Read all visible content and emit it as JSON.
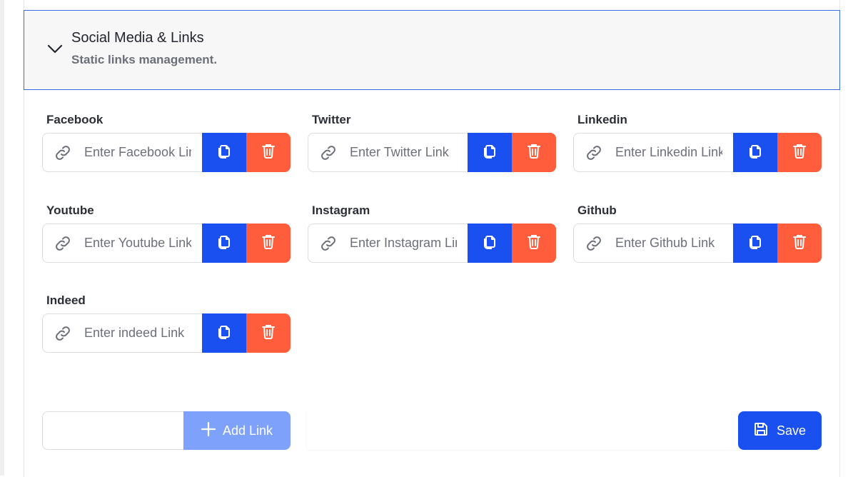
{
  "header": {
    "title": "Social Media & Links",
    "subtitle": "Static links management."
  },
  "fields": [
    {
      "label": "Facebook",
      "placeholder": "Enter Facebook Link"
    },
    {
      "label": "Twitter",
      "placeholder": "Enter Twitter Link"
    },
    {
      "label": "Linkedin",
      "placeholder": "Enter Linkedin Link"
    },
    {
      "label": "Youtube",
      "placeholder": "Enter Youtube Link"
    },
    {
      "label": "Instagram",
      "placeholder": "Enter Instagram Link"
    },
    {
      "label": "Github",
      "placeholder": "Enter Github Link"
    },
    {
      "label": "Indeed",
      "placeholder": "Enter indeed Link"
    }
  ],
  "add": {
    "label": "Add Link",
    "value": ""
  },
  "save": {
    "label": "Save"
  },
  "colors": {
    "primary": "#1a4ff0",
    "danger": "#ff5d3c",
    "add_disabled": "#7ea1fb",
    "header_border": "#3b6ce8"
  },
  "icons": {
    "chevron": "chevron-down-icon",
    "link": "link-icon",
    "copy": "copy-icon",
    "delete": "trash-icon",
    "add": "plus-icon",
    "save": "floppy-disk-icon"
  }
}
